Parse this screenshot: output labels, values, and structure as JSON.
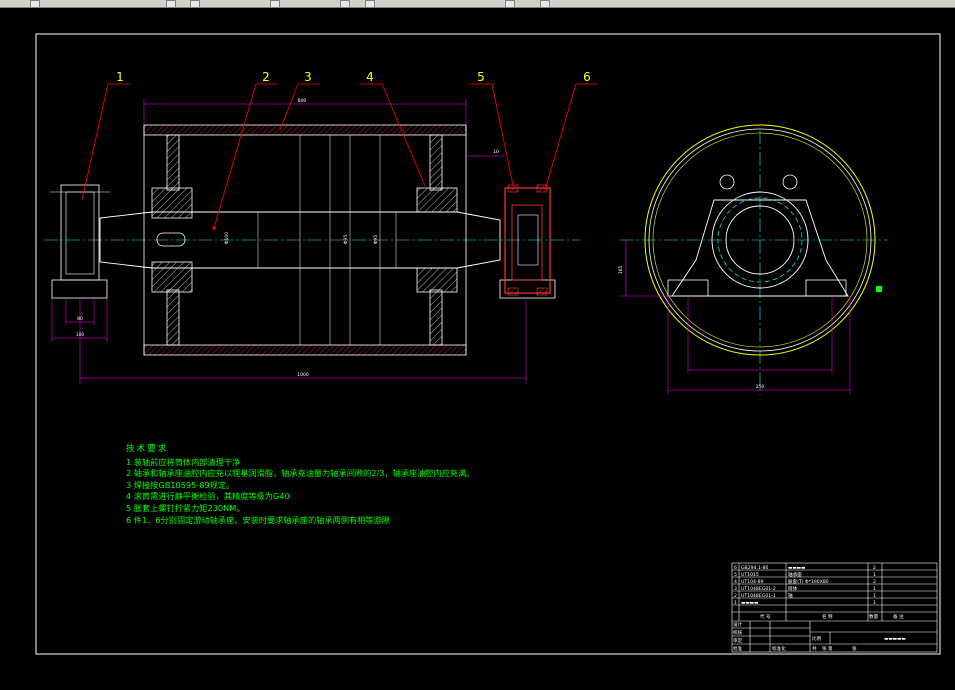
{
  "colors": {
    "background": "#000000",
    "frame": "#ffffff",
    "part_lines": "#ffffff",
    "leader": "#ff0000",
    "dimension": "#ff00ff",
    "center_line": "#00ffff",
    "hatch": "#ffffff",
    "tube_edge": "#ffff00",
    "notes_text": "#00ff00",
    "balloon_numbers": "#ffff00"
  },
  "balloons": [
    "1",
    "2",
    "3",
    "4",
    "5",
    "6"
  ],
  "dimensions": {
    "tube_length": "800",
    "shaft_length": "1000",
    "bearing_block_width": "80",
    "bearing_base_width": "100",
    "side_offset": "10",
    "diameter_1": "Φ100",
    "diameter_2": "Φ95",
    "diameter_3": "Φ95",
    "center_height": "165",
    "base_span": "250"
  },
  "technical_requirements": {
    "title": "技术要求",
    "items": [
      "1 装轴前应将筒体内部清理干净",
      "2 轴承和轴承座油腔内应充以锂基润滑脂，轴承充油量为轴承间隙的2/3，轴承座油腔内应充满。",
      "3 焊接按GB10595-89规定。",
      "4 滚筒需进行静平衡检验，其精度等级为G40",
      "5 胀套上螺钉拧紧力矩230NM。",
      "6 件1、6分别固定游动轴承座。安装时要求轴承座的轴承两侧有相等游隙"
    ]
  },
  "title_block": {
    "parts": [
      {
        "no": "6",
        "code": "GB294.1-86",
        "name": "▬▬▬▬",
        "qty": "2"
      },
      {
        "no": "5",
        "code": "UT1015",
        "name": "轴承座",
        "qty": "1"
      },
      {
        "no": "4",
        "code": "UT104-89",
        "name": "胀套(T) Φ*190X80",
        "qty": "2"
      },
      {
        "no": "3",
        "code": "UT1048EG01-2",
        "name": "筒体",
        "qty": "1"
      },
      {
        "no": "2",
        "code": "UT1048EG01-1",
        "name": "轴",
        "qty": "1"
      },
      {
        "no": "1",
        "code": "▬▬▬▬",
        "name": "",
        "qty": "1"
      }
    ],
    "header": {
      "code": "代 号",
      "name": "名  称",
      "qty": "数量",
      "note": "备 注"
    },
    "sign_rows": [
      "设计",
      "校核",
      "审定",
      "批准"
    ],
    "mid_label": "标准化",
    "scale_label": "比例",
    "drawing_no": "▬▬▬▬▬",
    "bottom_labels": [
      "共",
      "张  第",
      "张"
    ]
  }
}
